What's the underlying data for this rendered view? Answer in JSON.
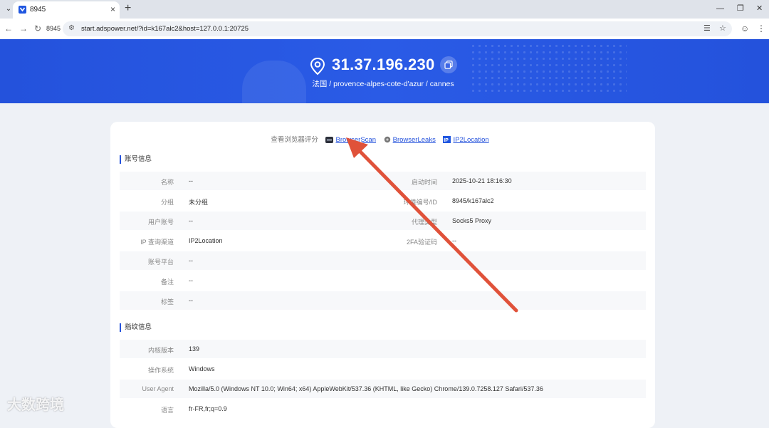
{
  "browser": {
    "tab_title": "8945",
    "profile_label": "8945",
    "url": "start.adspower.net/?id=k167alc2&host=127.0.0.1:20725"
  },
  "banner": {
    "ip": "31.37.196.230",
    "location": "法国 / provence-alpes-cote-d'azur / cannes"
  },
  "eval": {
    "label": "查看浏览器评分",
    "links": [
      "BrowserScan",
      "BrowserLeaks",
      "IP2Location"
    ]
  },
  "account_section": {
    "title": "账号信息",
    "rows": [
      {
        "label": "名称",
        "value": "--",
        "label2": "启动时间",
        "value2": "2025-10-21 18:16:30"
      },
      {
        "label": "分组",
        "value": "未分组",
        "label2": "环境编号/ID",
        "value2": "8945/k167alc2"
      },
      {
        "label": "用户账号",
        "value": "--",
        "label2": "代理类型",
        "value2": "Socks5 Proxy"
      },
      {
        "label": "IP 查询渠道",
        "value": "IP2Location",
        "label2": "2FA验证码",
        "value2": "--"
      },
      {
        "label": "账号平台",
        "value": "--"
      },
      {
        "label": "备注",
        "value": "--"
      },
      {
        "label": "标签",
        "value": "--"
      }
    ]
  },
  "fingerprint_section": {
    "title": "指纹信息",
    "rows": [
      {
        "label": "内核版本",
        "value": "139"
      },
      {
        "label": "操作系统",
        "value": "Windows"
      },
      {
        "label": "User Agent",
        "value": "Mozilla/5.0 (Windows NT 10.0; Win64; x64) AppleWebKit/537.36 (KHTML, like Gecko) Chrome/139.0.7258.127 Safari/537.36"
      },
      {
        "label": "语言",
        "value": "fr-FR,fr;q=0.9"
      }
    ]
  },
  "watermark": "大数跨境",
  "colors": {
    "brand": "#2452dc",
    "arrow": "#e0523a"
  }
}
